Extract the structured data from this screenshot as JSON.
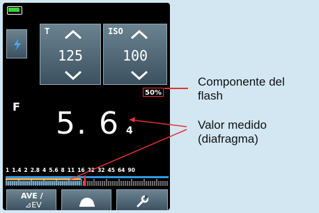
{
  "device": {
    "battery_icon": "battery-full-icon",
    "flash_icon": "flash-bolt-icon",
    "t_panel": {
      "label": "T",
      "value": "125"
    },
    "iso_panel": {
      "label": "ISO",
      "value": "100"
    },
    "flash_percent": "50%",
    "f_label": "F",
    "f_value": "5. 6",
    "f_subscript": "4",
    "scale_labels": [
      "1",
      "1.4",
      "2",
      "2.8",
      "4",
      "5.6",
      "8",
      "11",
      "16",
      "22",
      "32",
      "45",
      "64",
      "90"
    ],
    "measured_fraction": 0.48,
    "ave_button": {
      "line1": "AVE /",
      "line2": "⊿EV"
    },
    "dome_icon": "dome-icon",
    "wrench_icon": "wrench-icon"
  },
  "annotations": {
    "flash_component": {
      "line1": "Componente del",
      "line2": "flash"
    },
    "measured_value": {
      "line1": "Valor medido",
      "line2": "(diafragma)"
    }
  },
  "colors": {
    "background": "#d2e7f2",
    "screen": "#000000",
    "scale_blue": "#2f9ae6",
    "scale_orange": "#f3a33a",
    "marker_red": "#e33333",
    "battery_green": "#35d435"
  }
}
